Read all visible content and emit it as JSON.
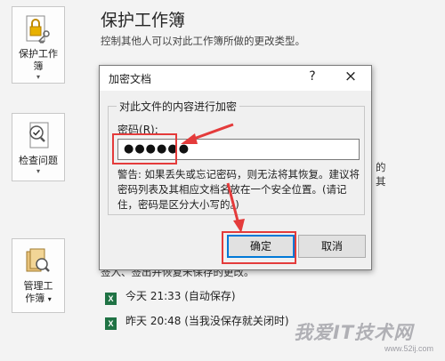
{
  "left_panel": {
    "protect_workbook": {
      "label": "保护工作簿"
    },
    "inspect_issues": {
      "label": "检查问题"
    },
    "manage_workbook": {
      "label_line1": "管理工",
      "label_line2": "作簿"
    }
  },
  "protect_section": {
    "title": "保护工作簿",
    "description": "控制其他人可以对此工作簿所做的更改类型。"
  },
  "background": {
    "manage_text": "签入、签出并恢复未保存的更改。",
    "right_cut_1": "的",
    "right_cut_2": "其",
    "versions": [
      {
        "icon": "X",
        "text": "今天 21:33 (自动保存)"
      },
      {
        "icon": "X",
        "text": "昨天 20:48 (当我没保存就关闭时)"
      }
    ]
  },
  "dialog": {
    "title": "加密文档",
    "help": "?",
    "close": "×",
    "group_label": "对此文件的内容进行加密",
    "password_label_prefix": "密码(",
    "password_label_key": "R",
    "password_label_suffix": "):",
    "password_value": "●●●●●●",
    "warning": "警告: 如果丢失或忘记密码，则无法将其恢复。建议将密码列表及其相应文档名放在一个安全位置。(请记住，密码是区分大小写的。)",
    "ok_label": "确定",
    "cancel_label": "取消"
  },
  "watermark": {
    "text": "我爱IT技术网",
    "url": "www.52ij.com"
  },
  "colors": {
    "highlight": "#e43b3b",
    "ok_border": "#0078d7",
    "excel_green": "#1f7244"
  }
}
